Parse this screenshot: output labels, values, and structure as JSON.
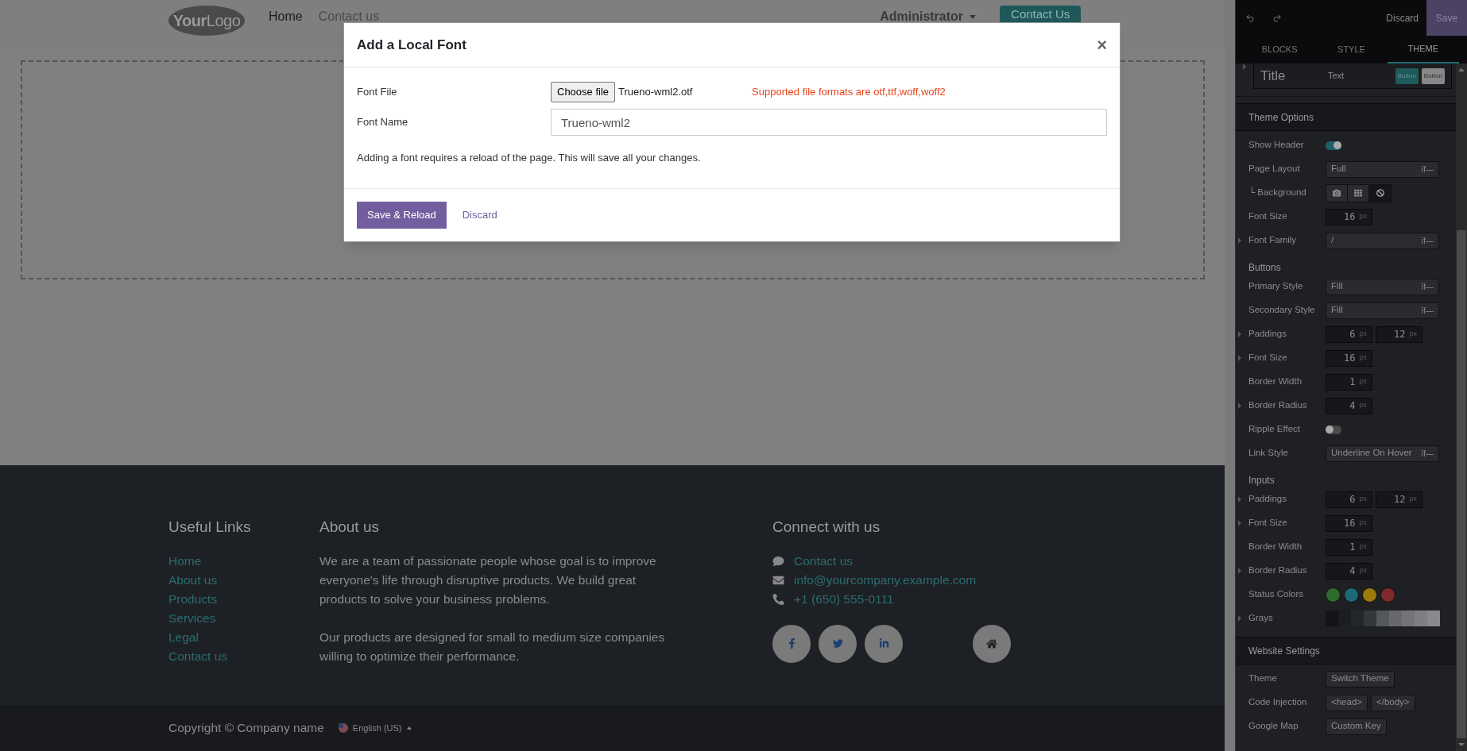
{
  "nav": {
    "logo": "**Your**Logo",
    "links": [
      {
        "label": "Home",
        "selected": true
      },
      {
        "label": "Contact us",
        "selected": false
      }
    ],
    "user": "Administrator",
    "cta": "Contact Us"
  },
  "modal": {
    "title": "Add a Local Font",
    "close": "×",
    "font_file": {
      "label": "Font File",
      "button": "Choose file",
      "file_name": "Trueno-wml2.otf",
      "hint": "Supported file formats are otf,ttf,woff,woff2"
    },
    "font_name": {
      "label": "Font Name",
      "value": "Trueno-wml2"
    },
    "note": "Adding a font requires a reload of the page. This will save all your changes.",
    "buttons": [
      {
        "label": "Save & Reload",
        "kind": "primary"
      },
      {
        "label": "Discard",
        "kind": "link"
      }
    ]
  },
  "footer": {
    "useful_links": {
      "title": "Useful Links",
      "links": [
        "Home",
        "About us",
        "Products",
        "Services",
        "Legal",
        "Contact us"
      ]
    },
    "about": {
      "title": "About us",
      "paragraphs": [
        "We are a team of passionate people whose goal is to improve everyone's life through disruptive products. We build great products to solve your business problems.",
        "Our products are designed for small to medium size companies willing to optimize their performance."
      ]
    },
    "connect": {
      "title": "Connect with us",
      "items": [
        {
          "kind": "chat",
          "label": "Contact us"
        },
        {
          "kind": "mail",
          "label": "info@yourcompany.example.com"
        },
        {
          "kind": "phone",
          "label": "+1 (650) 555-0111"
        }
      ],
      "social": [
        {
          "kind": "facebook"
        },
        {
          "kind": "twitter"
        },
        {
          "kind": "linkedin"
        },
        {
          "kind": "home"
        }
      ]
    },
    "copyright": "Copyright © Company name",
    "language": "English (US)"
  },
  "panel": {
    "discard": "Discard",
    "save": "Save",
    "tabs": [
      {
        "label": "BLOCKS",
        "selected": false
      },
      {
        "label": "STYLE",
        "selected": false
      },
      {
        "label": "THEME",
        "selected": true
      }
    ],
    "preview": {
      "title": "Title",
      "text": "Text",
      "buttons": [
        {
          "label": "Button",
          "kind": "primary"
        },
        {
          "label": "Button",
          "kind": "secondary"
        }
      ]
    },
    "sections": [
      {
        "title": "Theme Options",
        "kind": "band",
        "rows": [
          {
            "kind": "toggle",
            "label": "Show Header",
            "expandable": false,
            "on": true
          },
          {
            "kind": "select",
            "label": "Page Layout",
            "expandable": false,
            "value": "Full",
            "suffix": "ïf—"
          },
          {
            "kind": "icons",
            "label": "└ Background",
            "expandable": false
          },
          {
            "kind": "number",
            "label": "Font Size",
            "expandable": false,
            "values": [
              {
                "value": "16",
                "unit": "px"
              }
            ]
          },
          {
            "kind": "select",
            "label": "Font Family",
            "expandable": true,
            "value": "/",
            "suffix": "ïf—"
          }
        ]
      },
      {
        "title": "Buttons",
        "kind": "plain",
        "rows": [
          {
            "kind": "select",
            "label": "Primary Style",
            "expandable": false,
            "value": "Fill",
            "suffix": "ïf—"
          },
          {
            "kind": "select",
            "label": "Secondary Style",
            "expandable": false,
            "value": "Fill",
            "suffix": "ïf—"
          },
          {
            "kind": "number",
            "label": "Paddings",
            "expandable": true,
            "values": [
              {
                "value": "6",
                "unit": "px"
              },
              {
                "value": "12",
                "unit": "px"
              }
            ]
          },
          {
            "kind": "number",
            "label": "Font Size",
            "expandable": true,
            "values": [
              {
                "value": "16",
                "unit": "px"
              }
            ]
          },
          {
            "kind": "number",
            "label": "Border Width",
            "expandable": false,
            "values": [
              {
                "value": "1",
                "unit": "px"
              }
            ]
          },
          {
            "kind": "number",
            "label": "Border Radius",
            "expandable": true,
            "values": [
              {
                "value": "4",
                "unit": "px"
              }
            ]
          },
          {
            "kind": "toggle",
            "label": "Ripple Effect",
            "expandable": false,
            "on": false
          },
          {
            "kind": "select",
            "label": "Link Style",
            "expandable": false,
            "value": "Underline On Hover",
            "suffix": "ïf—"
          }
        ]
      },
      {
        "title": "Inputs",
        "kind": "plain",
        "rows": [
          {
            "kind": "number",
            "label": "Paddings",
            "expandable": true,
            "values": [
              {
                "value": "6",
                "unit": "px"
              },
              {
                "value": "12",
                "unit": "px"
              }
            ]
          },
          {
            "kind": "number",
            "label": "Font Size",
            "expandable": true,
            "values": [
              {
                "value": "16",
                "unit": "px"
              }
            ]
          },
          {
            "kind": "number",
            "label": "Border Width",
            "expandable": false,
            "values": [
              {
                "value": "1",
                "unit": "px"
              }
            ]
          },
          {
            "kind": "number",
            "label": "Border Radius",
            "expandable": true,
            "values": [
              {
                "value": "4",
                "unit": "px"
              }
            ]
          },
          {
            "kind": "colors",
            "label": "Status Colors",
            "expandable": false,
            "colors": [
              {
                "color": "#2e6b2e"
              },
              {
                "color": "#1f6878"
              },
              {
                "color": "#9b7a0c"
              },
              {
                "color": "#7f2a2a"
              }
            ]
          },
          {
            "kind": "grays",
            "label": "Grays",
            "expandable": true,
            "colors": [
              {
                "color": "#131416"
              },
              {
                "color": "#1b1d20"
              },
              {
                "color": "#24272a"
              },
              {
                "color": "#33363a"
              },
              {
                "color": "#54575b"
              },
              {
                "color": "#67696c"
              },
              {
                "color": "#727477"
              },
              {
                "color": "#7d7f82"
              },
              {
                "color": "#898a8c"
              }
            ]
          }
        ]
      },
      {
        "title": "Website Settings",
        "kind": "band",
        "rows": [
          {
            "kind": "buttons",
            "label": "Theme",
            "expandable": false,
            "buttons": [
              "Switch Theme"
            ]
          },
          {
            "kind": "buttons",
            "label": "Code Injection",
            "expandable": false,
            "buttons": [
              "<head>",
              "</body>"
            ]
          },
          {
            "kind": "buttons",
            "label": "Google Map",
            "expandable": false,
            "buttons": [
              "Custom Key"
            ]
          }
        ]
      }
    ]
  }
}
